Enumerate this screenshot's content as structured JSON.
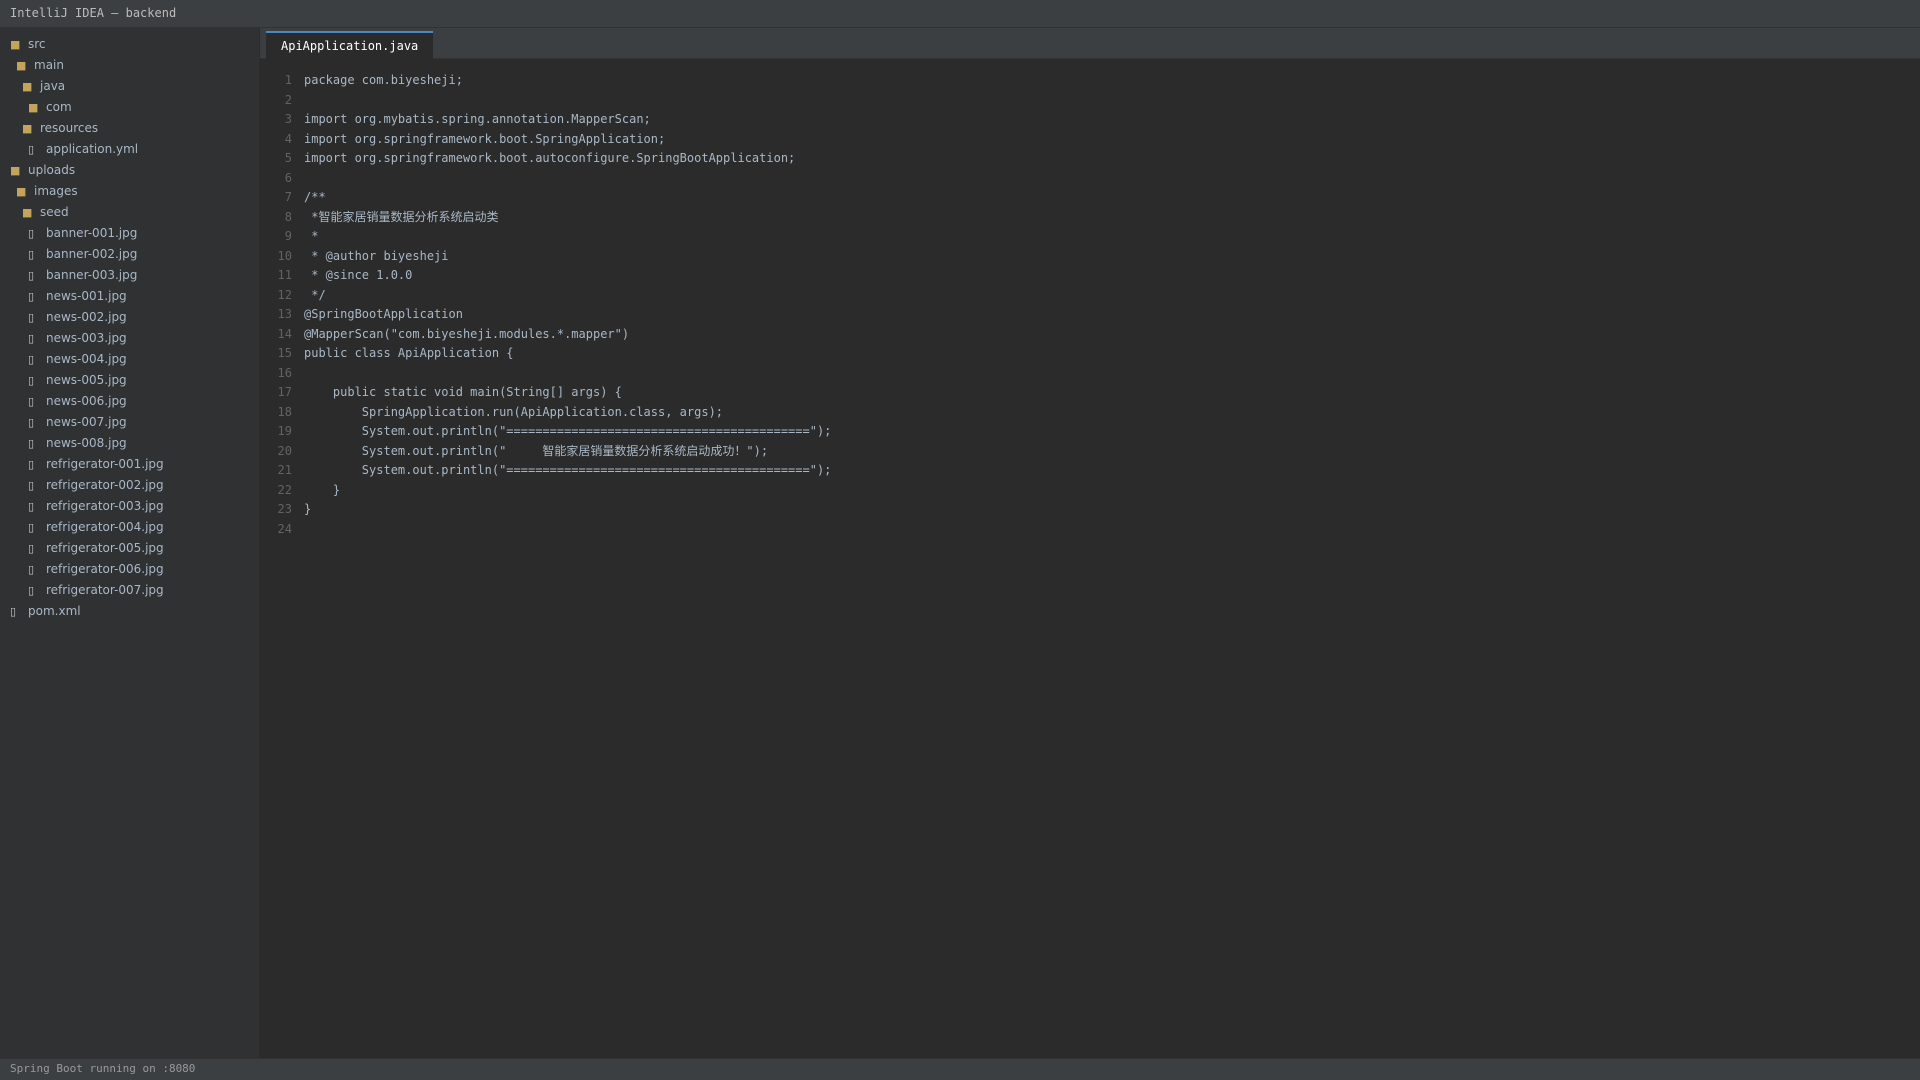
{
  "window": {
    "title": "IntelliJ IDEA — backend"
  },
  "project_tree": [
    {
      "label": "src",
      "type": "folder",
      "depth": 0
    },
    {
      "label": "main",
      "type": "folder",
      "depth": 1
    },
    {
      "label": "java",
      "type": "folder",
      "depth": 2
    },
    {
      "label": "com",
      "type": "folder",
      "depth": 3
    },
    {
      "label": "resources",
      "type": "folder",
      "depth": 2
    },
    {
      "label": "application.yml",
      "type": "file",
      "depth": 3
    },
    {
      "label": "uploads",
      "type": "folder",
      "depth": 0
    },
    {
      "label": "images",
      "type": "folder",
      "depth": 1
    },
    {
      "label": "seed",
      "type": "folder",
      "depth": 2
    },
    {
      "label": "banner-001.jpg",
      "type": "file",
      "depth": 3
    },
    {
      "label": "banner-002.jpg",
      "type": "file",
      "depth": 3
    },
    {
      "label": "banner-003.jpg",
      "type": "file",
      "depth": 3
    },
    {
      "label": "news-001.jpg",
      "type": "file",
      "depth": 3
    },
    {
      "label": "news-002.jpg",
      "type": "file",
      "depth": 3
    },
    {
      "label": "news-003.jpg",
      "type": "file",
      "depth": 3
    },
    {
      "label": "news-004.jpg",
      "type": "file",
      "depth": 3
    },
    {
      "label": "news-005.jpg",
      "type": "file",
      "depth": 3
    },
    {
      "label": "news-006.jpg",
      "type": "file",
      "depth": 3
    },
    {
      "label": "news-007.jpg",
      "type": "file",
      "depth": 3
    },
    {
      "label": "news-008.jpg",
      "type": "file",
      "depth": 3
    },
    {
      "label": "refrigerator-001.jpg",
      "type": "file",
      "depth": 3
    },
    {
      "label": "refrigerator-002.jpg",
      "type": "file",
      "depth": 3
    },
    {
      "label": "refrigerator-003.jpg",
      "type": "file",
      "depth": 3
    },
    {
      "label": "refrigerator-004.jpg",
      "type": "file",
      "depth": 3
    },
    {
      "label": "refrigerator-005.jpg",
      "type": "file",
      "depth": 3
    },
    {
      "label": "refrigerator-006.jpg",
      "type": "file",
      "depth": 3
    },
    {
      "label": "refrigerator-007.jpg",
      "type": "file",
      "depth": 3
    },
    {
      "label": "pom.xml",
      "type": "file",
      "depth": 0
    }
  ],
  "editor": {
    "active_tab": "ApiApplication.java",
    "lines": [
      {
        "n": "1",
        "text": "package com.biyesheji;"
      },
      {
        "n": "2",
        "text": ""
      },
      {
        "n": "3",
        "text": "import org.mybatis.spring.annotation.MapperScan;"
      },
      {
        "n": "4",
        "text": "import org.springframework.boot.SpringApplication;"
      },
      {
        "n": "5",
        "text": "import org.springframework.boot.autoconfigure.SpringBootApplication;"
      },
      {
        "n": "6",
        "text": ""
      },
      {
        "n": "7",
        "text": "/**"
      },
      {
        "n": "8",
        "text": " *智能家居销量数据分析系统启动类"
      },
      {
        "n": "9",
        "text": " *"
      },
      {
        "n": "10",
        "text": " * @author biyesheji"
      },
      {
        "n": "11",
        "text": " * @since 1.0.0"
      },
      {
        "n": "12",
        "text": " */"
      },
      {
        "n": "13",
        "text": "@SpringBootApplication"
      },
      {
        "n": "14",
        "text": "@MapperScan(\"com.biyesheji.modules.*.mapper\")"
      },
      {
        "n": "15",
        "text": "public class ApiApplication {"
      },
      {
        "n": "16",
        "text": ""
      },
      {
        "n": "17",
        "text": "    public static void main(String[] args) {"
      },
      {
        "n": "18",
        "text": "        SpringApplication.run(ApiApplication.class, args);"
      },
      {
        "n": "19",
        "text": "        System.out.println(\"==========================================\");"
      },
      {
        "n": "20",
        "text": "        System.out.println(\"     智能家居销量数据分析系统启动成功！\");"
      },
      {
        "n": "21",
        "text": "        System.out.println(\"==========================================\");"
      },
      {
        "n": "22",
        "text": "    }"
      },
      {
        "n": "23",
        "text": "}"
      },
      {
        "n": "24",
        "text": ""
      }
    ]
  },
  "statusbar": {
    "text": "Spring Boot running on :8080"
  },
  "icons": {
    "folder": "folder-icon",
    "file": "file-icon"
  },
  "colors": {
    "background": "#2b2b2b",
    "panel": "#3c3f41",
    "accent": "#4a88c7",
    "code_text": "#a9b7c6",
    "line_number": "#606366"
  }
}
